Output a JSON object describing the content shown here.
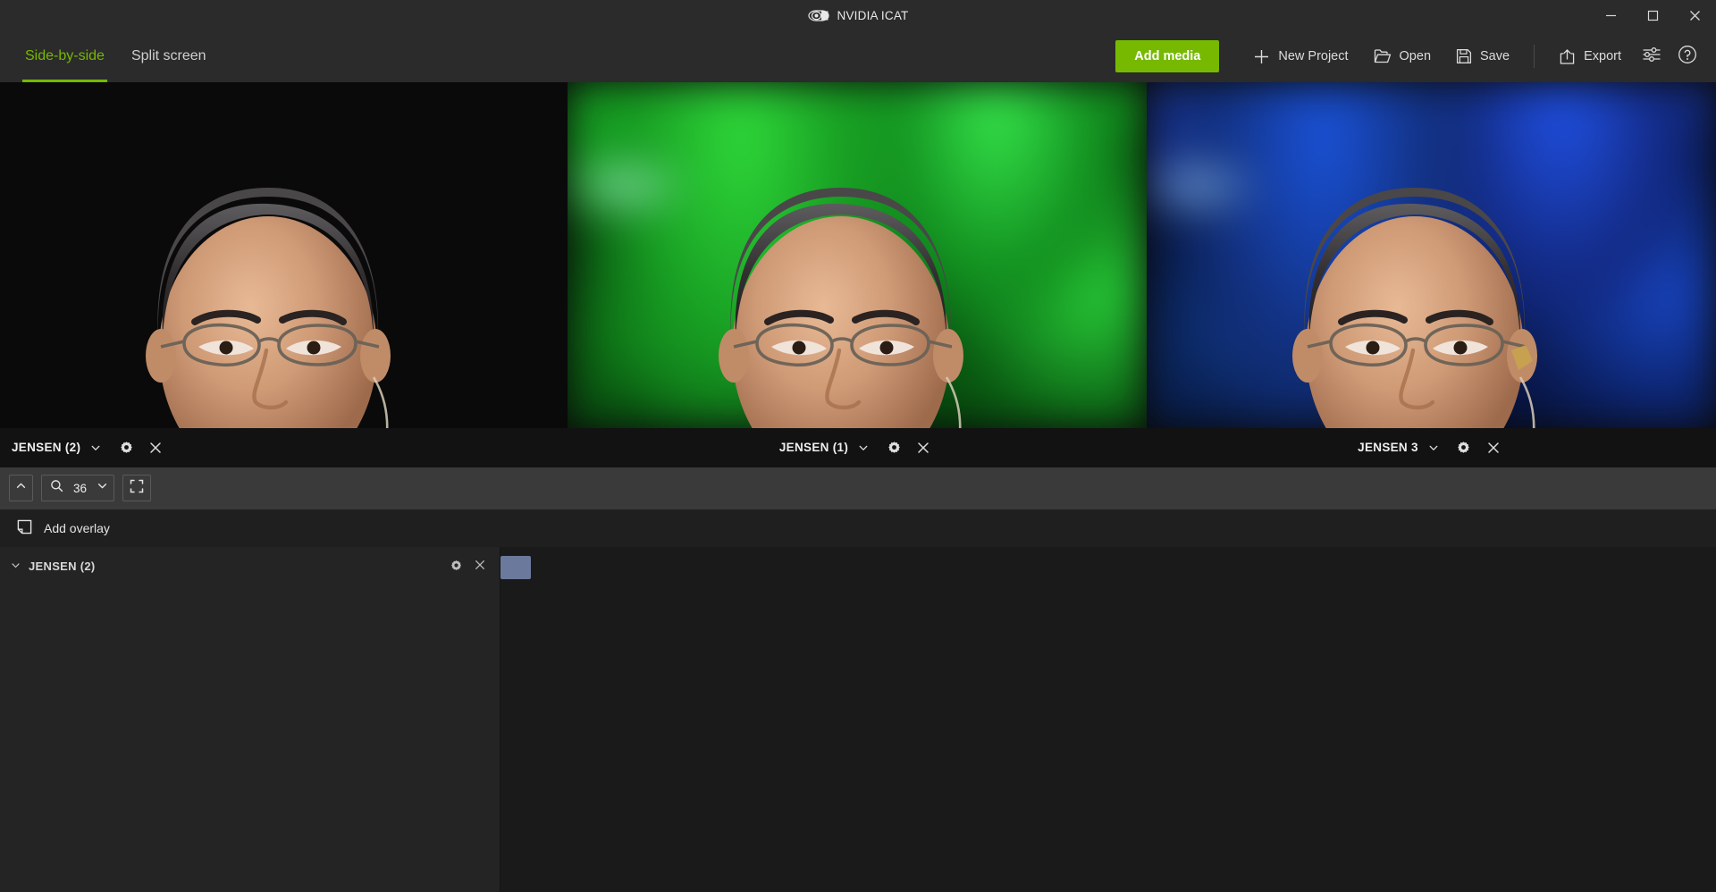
{
  "window": {
    "title": "NVIDIA ICAT",
    "logo_icon": "nvidia-eye-icon",
    "controls": {
      "minimize": "minimize-icon",
      "maximize": "maximize-icon",
      "close": "close-icon"
    }
  },
  "toolbar": {
    "tabs": [
      {
        "label": "Side-by-side",
        "active": true
      },
      {
        "label": "Split screen",
        "active": false
      }
    ],
    "add_media_label": "Add media",
    "actions": [
      {
        "label": "New Project",
        "icon": "plus-icon"
      },
      {
        "label": "Open",
        "icon": "folder-open-icon"
      },
      {
        "label": "Save",
        "icon": "floppy-disk-icon"
      },
      {
        "label": "Export",
        "icon": "export-upload-icon"
      }
    ],
    "settings_icon": "sliders-icon",
    "help_icon": "help-circle-icon",
    "accent_color": "#76b900"
  },
  "viewer": {
    "mode": "side-by-side",
    "panes": [
      {
        "label": "JENSEN (2)",
        "tint": "#c41c78",
        "tint_name": "magenta"
      },
      {
        "label": "JENSEN (1)",
        "tint": "#179c22",
        "tint_name": "green"
      },
      {
        "label": "JENSEN 3",
        "tint": "#12307f",
        "tint_name": "blue"
      }
    ],
    "pane_controls": {
      "dropdown_icon": "chevron-down-icon",
      "settings_icon": "gear-icon",
      "close_icon": "close-icon"
    }
  },
  "zoombar": {
    "collapse_icon": "chevron-up-icon",
    "search_icon": "magnifier-icon",
    "zoom_value": "36",
    "dropdown_icon": "chevron-down-icon",
    "fit_icon": "fit-to-screen-icon"
  },
  "overlay": {
    "add_overlay_label": "Add overlay",
    "add_overlay_icon": "overlay-box-icon"
  },
  "timeline": {
    "rows": [
      {
        "label": "JENSEN (2)",
        "dropdown_icon": "chevron-down-icon",
        "gear_icon": "gear-icon",
        "close_icon": "close-icon"
      }
    ]
  }
}
